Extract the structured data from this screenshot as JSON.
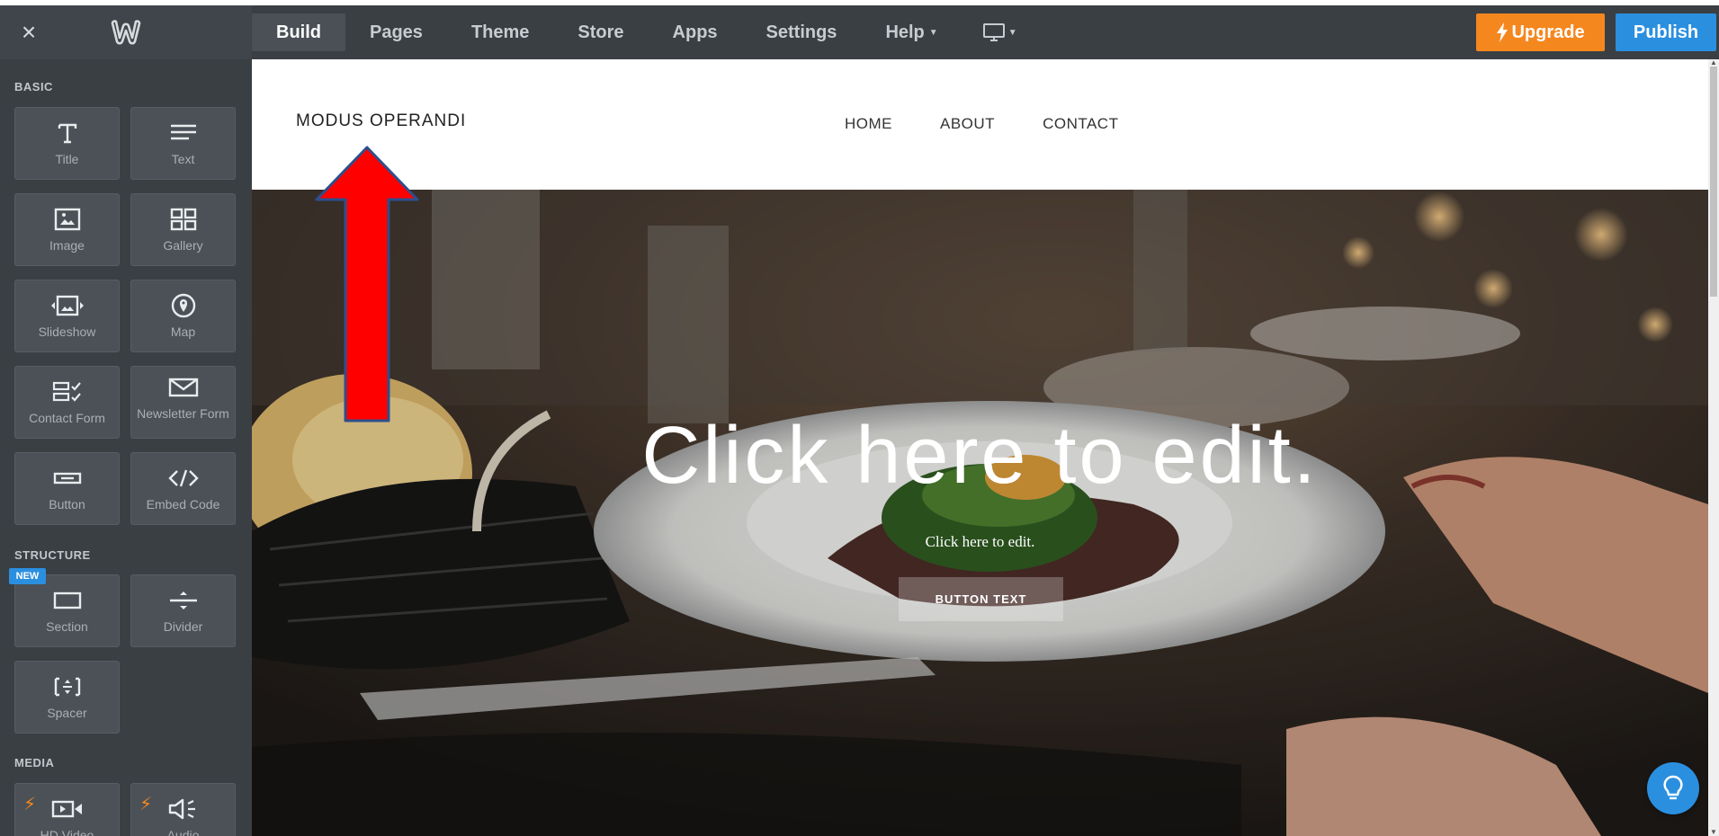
{
  "topbar": {
    "close_glyph": "×",
    "tabs": [
      {
        "label": "Build",
        "active": true
      },
      {
        "label": "Pages",
        "active": false
      },
      {
        "label": "Theme",
        "active": false
      },
      {
        "label": "Store",
        "active": false
      },
      {
        "label": "Apps",
        "active": false
      },
      {
        "label": "Settings",
        "active": false
      },
      {
        "label": "Help",
        "active": false
      }
    ],
    "upgrade_label": "Upgrade",
    "publish_label": "Publish",
    "device_icon": "desktop-icon"
  },
  "sidebar": {
    "sections": {
      "basic": "BASIC",
      "structure": "STRUCTURE",
      "media": "MEDIA"
    },
    "basic_items": [
      {
        "label": "Title",
        "icon": "title-icon"
      },
      {
        "label": "Text",
        "icon": "text-icon"
      },
      {
        "label": "Image",
        "icon": "image-icon"
      },
      {
        "label": "Gallery",
        "icon": "gallery-icon"
      },
      {
        "label": "Slideshow",
        "icon": "slideshow-icon"
      },
      {
        "label": "Map",
        "icon": "map-icon"
      },
      {
        "label": "Contact Form",
        "icon": "contact-form-icon"
      },
      {
        "label": "Newsletter Form",
        "icon": "newsletter-icon"
      },
      {
        "label": "Button",
        "icon": "button-icon"
      },
      {
        "label": "Embed Code",
        "icon": "embed-code-icon"
      }
    ],
    "structure_items": [
      {
        "label": "Section",
        "icon": "section-icon"
      },
      {
        "label": "Divider",
        "icon": "divider-icon"
      },
      {
        "label": "Spacer",
        "icon": "spacer-icon"
      }
    ],
    "new_badge": "NEW",
    "media_items": [
      {
        "label": "HD Video",
        "icon": "video-icon"
      },
      {
        "label": "Audio",
        "icon": "audio-icon"
      }
    ]
  },
  "site": {
    "title": "MODUS OPERANDI",
    "nav": [
      "HOME",
      "ABOUT",
      "CONTACT"
    ],
    "hero_title": "Click here to edit.",
    "hero_subtitle": "Click here to edit.",
    "hero_button": "BUTTON TEXT"
  },
  "colors": {
    "topbar": "#3a3f44",
    "upgrade": "#f5871f",
    "publish": "#2b8fe0",
    "annotation_arrow": "#ff0000"
  }
}
